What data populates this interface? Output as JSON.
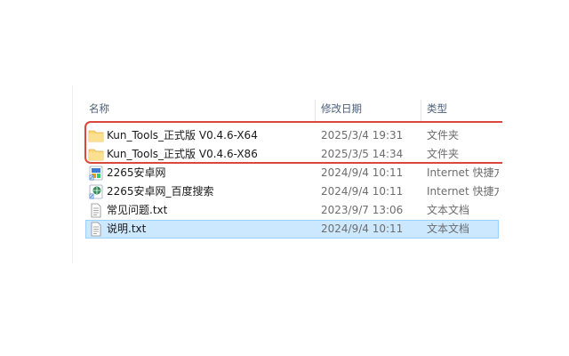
{
  "header": {
    "name_label": "名称",
    "date_label": "修改日期",
    "type_label": "类型",
    "sort_indicator": "chevron-up-icon"
  },
  "files": [
    {
      "name": "Kun_Tools_正式版 V0.4.6-X64",
      "modified": "2025/3/4 19:31",
      "type": "文件夹",
      "icon": "folder-icon"
    },
    {
      "name": "Kun_Tools_正式版 V0.4.6-X86",
      "modified": "2025/3/5 14:34",
      "type": "文件夹",
      "icon": "folder-icon"
    },
    {
      "name": "2265安卓网",
      "modified": "2024/9/4 10:11",
      "type": "Internet 快捷方",
      "icon": "internet-shortcut-icon"
    },
    {
      "name": "2265安卓网_百度搜索",
      "modified": "2024/9/4 10:11",
      "type": "Internet 快捷方",
      "icon": "internet-shortcut-icon"
    },
    {
      "name": "常见问题.txt",
      "modified": "2023/9/7 13:06",
      "type": "文本文档",
      "icon": "text-file-icon"
    },
    {
      "name": "说明.txt",
      "modified": "2024/9/4 10:11",
      "type": "文本文档",
      "icon": "text-file-icon",
      "selected": true
    }
  ],
  "colors": {
    "highlight_box": "#d9483b",
    "selection_bg": "#cce8ff",
    "folder": "#f8d775"
  }
}
